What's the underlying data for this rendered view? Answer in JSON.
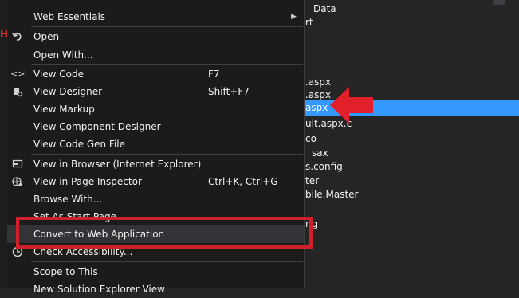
{
  "left_glyph": "H",
  "explorer": {
    "top_fragment": "Data",
    "files": [
      {
        "label": "Data",
        "selected": false
      },
      {
        "label": "rt",
        "selected": false
      },
      {
        "label": ".aspx",
        "selected": false
      },
      {
        "label": ".aspx",
        "selected": false
      },
      {
        "label": "aspx",
        "selected": true
      },
      {
        "label": "ult.aspx.c",
        "selected": false
      },
      {
        "label": "co",
        "selected": false
      },
      {
        "label": "sax",
        "selected": false
      },
      {
        "label": "s.config",
        "selected": false
      },
      {
        "label": "ter",
        "selected": false
      },
      {
        "label": "bile.Master",
        "selected": false
      },
      {
        "label": "ng",
        "selected": false
      }
    ]
  },
  "menu": {
    "items": [
      {
        "label": "Web Essentials",
        "shortcut": "",
        "icon": "",
        "submenu": true
      },
      {
        "label": "Open",
        "shortcut": "",
        "icon": "undo-arrow-icon",
        "submenu": false
      },
      {
        "label": "Open With...",
        "shortcut": "",
        "icon": "",
        "submenu": false
      },
      {
        "label": "View Code",
        "shortcut": "F7",
        "icon": "code-brackets-icon",
        "submenu": false
      },
      {
        "label": "View Designer",
        "shortcut": "Shift+F7",
        "icon": "designer-icon",
        "submenu": false
      },
      {
        "label": "View Markup",
        "shortcut": "",
        "icon": "",
        "submenu": false
      },
      {
        "label": "View Component Designer",
        "shortcut": "",
        "icon": "",
        "submenu": false
      },
      {
        "label": "View Code Gen File",
        "shortcut": "",
        "icon": "",
        "submenu": false
      },
      {
        "label": "View in Browser (Internet Explorer)",
        "shortcut": "",
        "icon": "browser-icon",
        "submenu": false
      },
      {
        "label": "View in Page Inspector",
        "shortcut": "Ctrl+K, Ctrl+G",
        "icon": "globe-icon",
        "submenu": false
      },
      {
        "label": "Browse With...",
        "shortcut": "",
        "icon": "",
        "submenu": false
      },
      {
        "label": "Set As Start Page",
        "shortcut": "",
        "icon": "",
        "submenu": false
      },
      {
        "label": "Convert to Web Application",
        "shortcut": "",
        "icon": "",
        "submenu": false
      },
      {
        "label": "Check Accessibility...",
        "shortcut": "",
        "icon": "accessibility-icon",
        "submenu": false
      },
      {
        "label": "Scope to This",
        "shortcut": "",
        "icon": "",
        "submenu": false
      },
      {
        "label": "New Solution Explorer View",
        "shortcut": "",
        "icon": "",
        "submenu": false
      }
    ],
    "highlighted_index": 12
  },
  "colors": {
    "menu_bg": "#1b1b1c",
    "hover_bg": "#333337",
    "selection_blue": "#3399ff",
    "annotation_red": "#d0202a"
  }
}
